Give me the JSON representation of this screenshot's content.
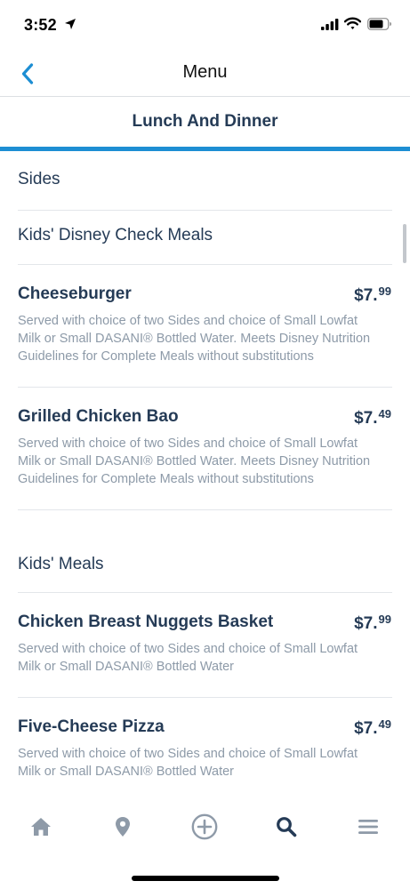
{
  "status_bar": {
    "time": "3:52"
  },
  "nav": {
    "title": "Menu",
    "back_icon": "chevron-left-icon"
  },
  "section": {
    "title": "Lunch And Dinner"
  },
  "categories": {
    "sides": "Sides",
    "kids_disney_check": "Kids' Disney Check Meals",
    "kids_meals": "Kids' Meals"
  },
  "items": [
    {
      "name": "Cheeseburger",
      "price_dollars": "$7.",
      "price_cents": "99",
      "description": "Served with choice of two Sides and choice of Small Lowfat Milk or Small DASANI® Bottled Water. Meets Disney Nutrition Guidelines for Complete Meals without substitutions"
    },
    {
      "name": "Grilled Chicken Bao",
      "price_dollars": "$7.",
      "price_cents": "49",
      "description": "Served with choice of two Sides and choice of Small Lowfat Milk or Small DASANI® Bottled Water. Meets Disney Nutrition Guidelines for Complete Meals without substitutions"
    },
    {
      "name": "Chicken Breast Nuggets Basket",
      "price_dollars": "$7.",
      "price_cents": "99",
      "description": "Served with choice of two Sides and choice of Small Lowfat Milk or Small DASANI® Bottled Water"
    },
    {
      "name": "Five-Cheese Pizza",
      "price_dollars": "$7.",
      "price_cents": "49",
      "description": "Served with choice of two Sides and choice of Small Lowfat Milk or Small DASANI® Bottled Water"
    }
  ],
  "tab_bar": {
    "tabs": [
      {
        "icon": "home-icon",
        "active": false
      },
      {
        "icon": "map-pin-icon",
        "active": false
      },
      {
        "icon": "plus-circle-icon",
        "active": false
      },
      {
        "icon": "search-icon",
        "active": true
      },
      {
        "icon": "menu-icon",
        "active": false
      }
    ]
  },
  "colors": {
    "accent": "#1d8ed3",
    "text_primary": "#253b56",
    "text_secondary": "#8d9aa8",
    "tab_inactive": "#8e9aa8",
    "tab_active": "#253b56"
  }
}
